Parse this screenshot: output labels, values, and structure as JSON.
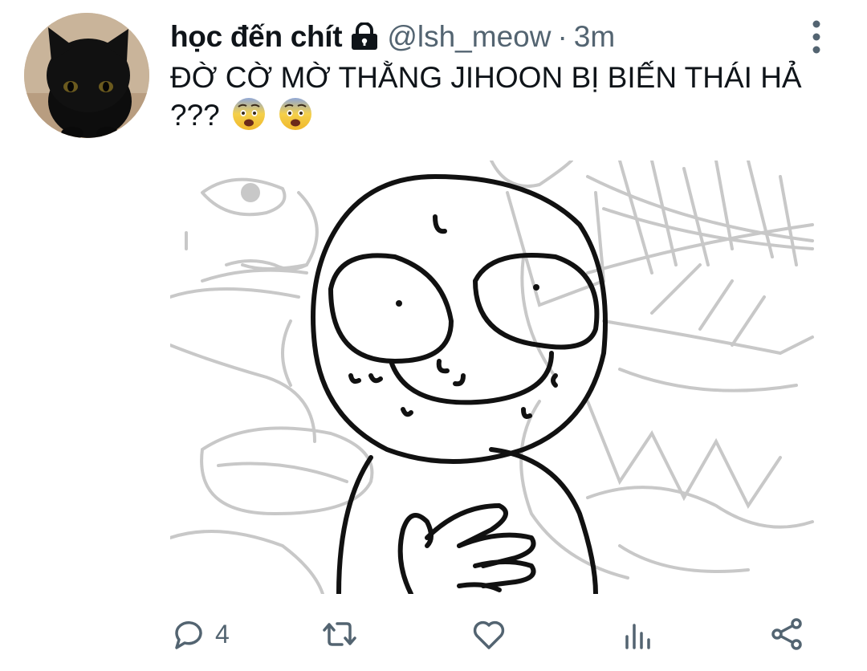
{
  "tweet": {
    "display_name": "học đến chít",
    "handle": "@lsh_meow",
    "separator": "·",
    "time": "3m",
    "text": "ĐỜ CỜ MỜ THẰNG JIHOON BỊ BIẾN THÁI HẢ ???",
    "emojis": [
      "fearful-face",
      "fearful-face"
    ],
    "protected_icon": "lock-icon",
    "avatar": "black-cat-avatar"
  },
  "actions": {
    "reply_count": "4",
    "icons": [
      "reply-icon",
      "retweet-icon",
      "like-icon",
      "analytics-icon",
      "share-icon"
    ]
  },
  "colors": {
    "text": "#0f1419",
    "secondary": "#536471",
    "background": "#ffffff"
  }
}
